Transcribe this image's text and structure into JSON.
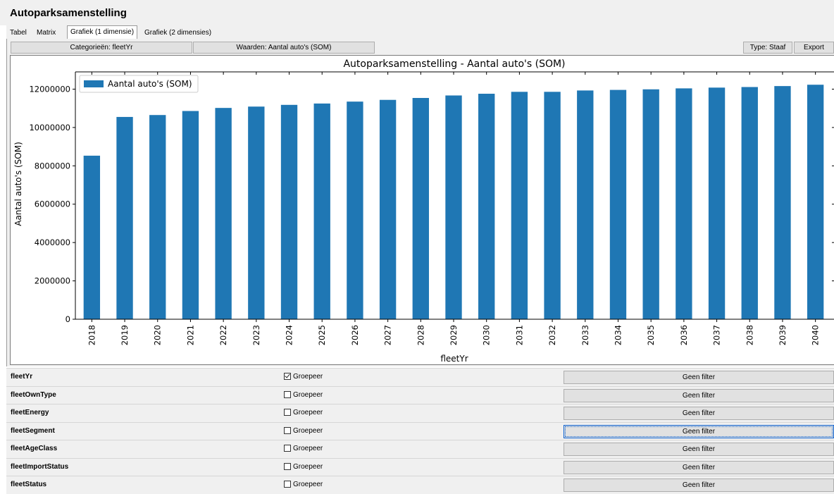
{
  "app": {
    "title": "Autoparksamenstelling"
  },
  "tabs": [
    {
      "label": "Tabel"
    },
    {
      "label": "Matrix"
    },
    {
      "label": "Grafiek (1 dimensie)",
      "active": true
    },
    {
      "label": "Grafiek (2 dimensies)"
    }
  ],
  "toolbar": {
    "categories_label": "Categorieën: fleetYr",
    "values_label": "Waarden: Aantal auto's (SOM)",
    "type_label": "Type: Staaf",
    "export_label": "Export"
  },
  "chart_data": {
    "type": "bar",
    "title": "Autoparksamenstelling - Aantal auto's (SOM)",
    "xlabel": "fleetYr",
    "ylabel": "Aantal auto's (SOM)",
    "ylim": [
      0,
      12900000
    ],
    "yticks": [
      0,
      2000000,
      4000000,
      6000000,
      8000000,
      10000000,
      12000000
    ],
    "ytick_labels": [
      "0",
      "2000000",
      "4000000",
      "6000000",
      "8000000",
      "10000000",
      "12000000"
    ],
    "legend_position": "top-left",
    "color": "#1f77b4",
    "categories": [
      "2018",
      "2019",
      "2020",
      "2021",
      "2022",
      "2023",
      "2024",
      "2025",
      "2026",
      "2027",
      "2028",
      "2029",
      "2030",
      "2031",
      "2032",
      "2033",
      "2034",
      "2035",
      "2036",
      "2037",
      "2038",
      "2039",
      "2040"
    ],
    "series": [
      {
        "name": "Aantal auto's (SOM)",
        "values": [
          8530000,
          10550000,
          10650000,
          10860000,
          11020000,
          11090000,
          11180000,
          11250000,
          11350000,
          11440000,
          11540000,
          11670000,
          11760000,
          11860000,
          11860000,
          11930000,
          11960000,
          11990000,
          12040000,
          12080000,
          12110000,
          12160000,
          12230000
        ]
      }
    ]
  },
  "filters": [
    {
      "name": "fleetYr",
      "group_label": "Groepeer",
      "checked": true,
      "filter_label": "Geen filter"
    },
    {
      "name": "fleetOwnType",
      "group_label": "Groepeer",
      "checked": false,
      "filter_label": "Geen filter"
    },
    {
      "name": "fleetEnergy",
      "group_label": "Groepeer",
      "checked": false,
      "filter_label": "Geen filter"
    },
    {
      "name": "fleetSegment",
      "group_label": "Groepeer",
      "checked": false,
      "filter_label": "Geen filter",
      "focused": true
    },
    {
      "name": "fleetAgeClass",
      "group_label": "Groepeer",
      "checked": false,
      "filter_label": "Geen filter"
    },
    {
      "name": "fleetImportStatus",
      "group_label": "Groepeer",
      "checked": false,
      "filter_label": "Geen filter"
    },
    {
      "name": "fleetStatus",
      "group_label": "Groepeer",
      "checked": false,
      "filter_label": "Geen filter"
    }
  ]
}
